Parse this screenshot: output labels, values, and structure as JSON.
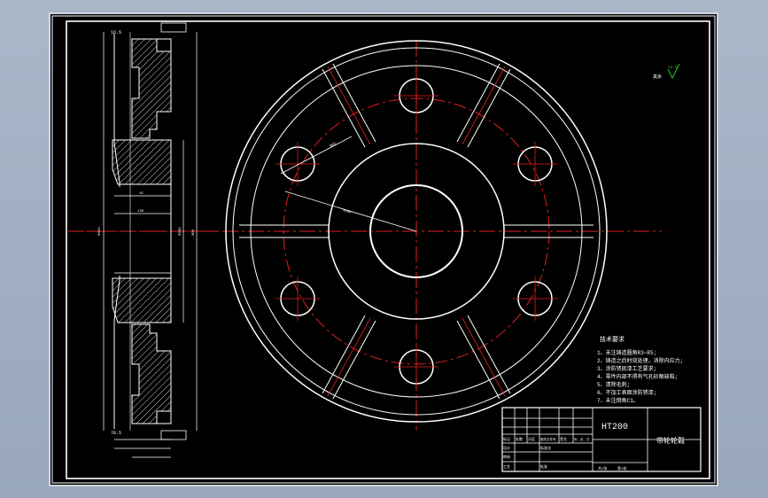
{
  "colors": {
    "background": "#000000",
    "stroke": "#ffffff",
    "centerline": "#e0201c",
    "accent": "#19c92b"
  },
  "drawing": {
    "material_code": "HT200",
    "part_name": "带轮轮毂",
    "roughness_label": "其余",
    "roughness_value": "12.5"
  },
  "tech_requirements": {
    "title": "技术要求",
    "items": [
      "1、未注铸造圆角R3~R5;",
      "2、铸造之后时效处理，消除内应力;",
      "3、涂防锈底漆工艺要求;",
      "4、零件内部不得有气孔砂眼缺陷;",
      "5、清除毛刺;",
      "6、不加工表面涂防锈漆;",
      "7、未注倒角C1。"
    ]
  },
  "title_block": {
    "row1": [
      "标记",
      "处数",
      "分区",
      "更改文件号",
      "签名",
      "年、月、日"
    ],
    "row2": [
      "设计",
      "",
      "标准化",
      ""
    ],
    "row3": [
      "审核",
      ""
    ],
    "row4": [
      "工艺",
      "",
      "批准",
      ""
    ],
    "scale_row": [
      "共1张",
      "第1张"
    ]
  },
  "dimensions": {
    "side_top": "16.5",
    "side_bottom": "78.5",
    "side_w1": "15",
    "side_w2": "130",
    "side_d1": "Φ450",
    "side_d2": "Φ280",
    "side_mid": "Φ90",
    "radial_a": "Φ55",
    "radial_b": "Φ280"
  }
}
